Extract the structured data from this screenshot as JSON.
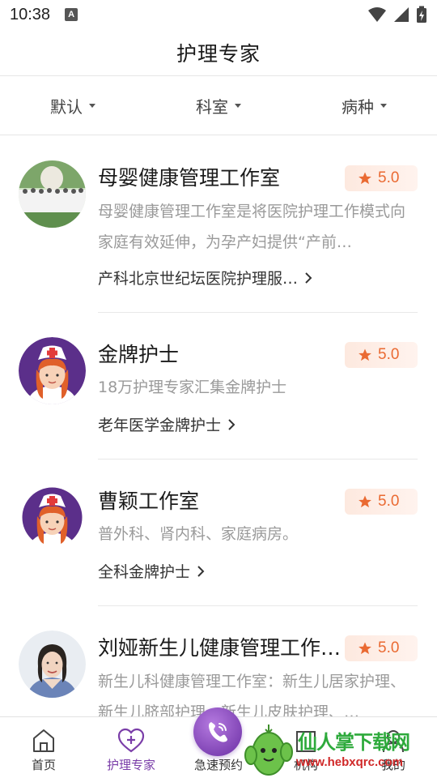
{
  "status_bar": {
    "time": "10:38",
    "notification_badge": "A"
  },
  "header": {
    "title": "护理专家"
  },
  "filters": [
    {
      "label": "默认"
    },
    {
      "label": "科室"
    },
    {
      "label": "病种"
    }
  ],
  "experts": [
    {
      "name": "母婴健康管理工作室",
      "rating": "5.0",
      "description": "母婴健康管理工作室是将医院护理工作模式向家庭有效延伸，为孕产妇提供“产前…",
      "tag": "产科北京世纪坛医院护理服…",
      "avatar": "group-photo"
    },
    {
      "name": "金牌护士",
      "rating": "5.0",
      "description": "18万护理专家汇集金牌护士",
      "tag": "老年医学金牌护士",
      "avatar": "nurse-illustration"
    },
    {
      "name": "曹颖工作室",
      "rating": "5.0",
      "description": "普外科、肾内科、家庭病房。",
      "tag": "全科金牌护士",
      "avatar": "nurse-illustration"
    },
    {
      "name": "刘娅新生儿健康管理工作…",
      "rating": "5.0",
      "description": "新生儿科健康管理工作室：新生儿居家护理、新生儿脐部护理、新生儿皮肤护理、…",
      "tag": "",
      "avatar": "woman-portrait"
    }
  ],
  "bottom_nav": {
    "items": [
      {
        "label": "首页",
        "icon": "home-icon"
      },
      {
        "label": "护理专家",
        "icon": "heart-plus-icon",
        "active": true
      },
      {
        "label": "急速预约",
        "icon": "phone-icon"
      },
      {
        "label": "机构",
        "icon": "building-icon"
      },
      {
        "label": "我的",
        "icon": "user-icon"
      }
    ]
  },
  "watermark": {
    "text": "仙人掌下载网",
    "url": "www.hebxqrc.com"
  },
  "colors": {
    "accent": "#7a3da8",
    "rating": "#ea6a32",
    "watermark_green": "#2eaa3c",
    "watermark_red": "#d02828"
  }
}
